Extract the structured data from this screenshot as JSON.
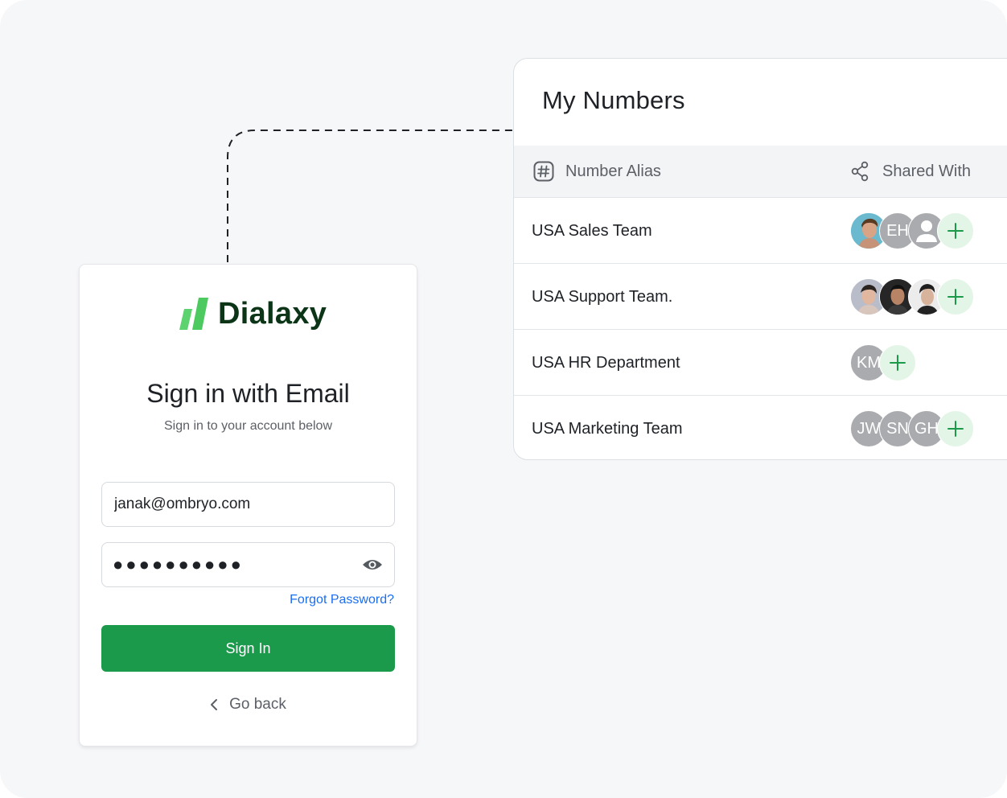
{
  "numbers": {
    "title": "My Numbers",
    "columns": {
      "alias": "Number Alias",
      "shared": "Shared With"
    },
    "rows": [
      {
        "name": "USA Sales Team",
        "avatars": [
          {
            "type": "photo",
            "name": "photo-avatar"
          },
          {
            "type": "initials",
            "text": "EH"
          },
          {
            "type": "placeholder",
            "name": "user-placeholder"
          }
        ]
      },
      {
        "name": "USA Support Team.",
        "avatars": [
          {
            "type": "photo",
            "name": "photo-avatar"
          },
          {
            "type": "photo",
            "name": "photo-avatar"
          },
          {
            "type": "photo",
            "name": "photo-avatar"
          }
        ]
      },
      {
        "name": "USA HR Department",
        "avatars": [
          {
            "type": "initials",
            "text": "KM"
          }
        ]
      },
      {
        "name": "USA Marketing Team",
        "avatars": [
          {
            "type": "initials",
            "text": "JW"
          },
          {
            "type": "initials",
            "text": "SN"
          },
          {
            "type": "initials",
            "text": "GH"
          }
        ]
      }
    ],
    "add_symbol": "+"
  },
  "login": {
    "brand": "Dialaxy",
    "heading": "Sign in with Email",
    "subheading": "Sign in to your account below",
    "email_value": "janak@ombryo.com",
    "password_mask": "●●●●●●●●●●",
    "forgot_label": "Forgot Password?",
    "signin_label": "Sign In",
    "goback_label": "Go back"
  },
  "colors": {
    "brand_green": "#1a9a4a",
    "logo_green": "#5dd36f",
    "link_blue": "#1a6ef0",
    "add_bg": "#e3f5e6"
  },
  "icons": {
    "alias": "hash-icon",
    "shared": "share-icon",
    "password": "eye-icon",
    "back": "chevron-left-icon"
  }
}
